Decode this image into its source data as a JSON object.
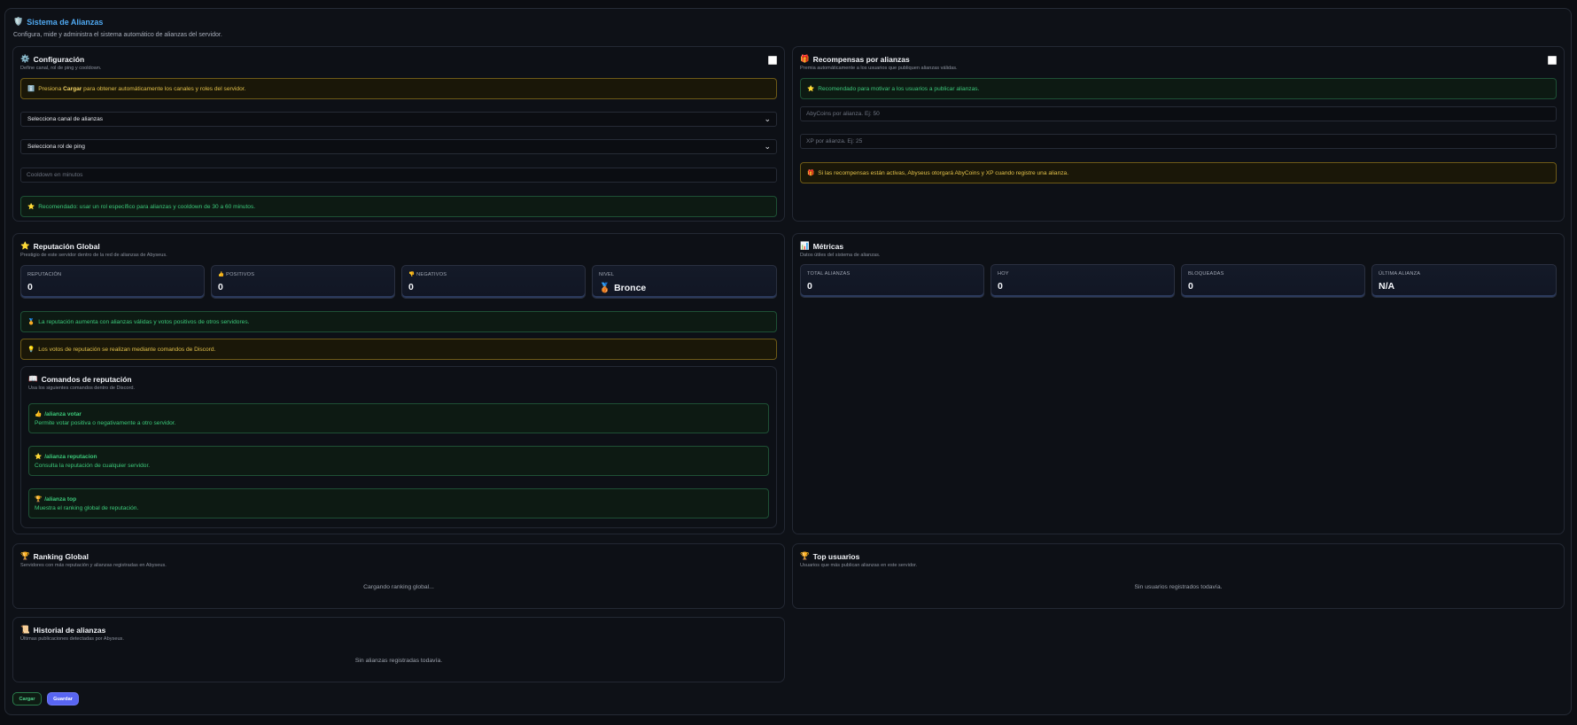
{
  "header": {
    "icon": "shield-icon",
    "title": "Sistema de Alianzas",
    "subtitle": "Configura, mide y administra el sistema automático de alianzas del servidor."
  },
  "config": {
    "icon": "gear-icon",
    "title": "Configuración",
    "subtitle": "Define canal, rol de ping y cooldown.",
    "notice_pre": "Presiona ",
    "notice_bold": "Cargar",
    "notice_post": " para obtener automáticamente los canales y roles del servidor.",
    "channel_select": "Selecciona canal de alianzas",
    "role_select": "Selecciona rol de ping",
    "cooldown_placeholder": "Cooldown en minutos",
    "recommend": "Recomendado: usar un rol específico para alianzas y cooldown de 30 a 60 minutos."
  },
  "rewards": {
    "icon": "gift-icon",
    "title": "Recompensas por alianzas",
    "subtitle": "Premia automáticamente a los usuarios que publiquen alianzas válidas.",
    "recommend": "Recomendado para motivar a los usuarios a publicar alianzas.",
    "abycoins_placeholder": "AbyCoins por alianza. Ej: 50",
    "xp_placeholder": "XP por alianza. Ej: 25",
    "info": "Si las recompensas están activas, Abyseus otorgará AbyCoins y XP cuando registre una alianza."
  },
  "reputation": {
    "icon": "star-icon",
    "title": "Reputación Global",
    "subtitle": "Prestigio de este servidor dentro de la red de alianzas de Abyseus.",
    "stats": [
      {
        "label": "REPUTACIÓN",
        "value": "0"
      },
      {
        "label": "POSITIVOS",
        "value": "0"
      },
      {
        "label": "NEGATIVOS",
        "value": "0"
      },
      {
        "label": "NIVEL",
        "value": "Bronce"
      }
    ],
    "notice_ok": "La reputación aumenta con alianzas válidas y votos positivos de otros servidores.",
    "notice_warn": "Los votos de reputación se realizan mediante comandos de Discord.",
    "commands": {
      "title": "Comandos de reputación",
      "subtitle": "Usa los siguientes comandos dentro de Discord.",
      "items": [
        {
          "name": "/alianza votar",
          "desc": "Permite votar positiva o negativamente a otro servidor."
        },
        {
          "name": "/alianza reputacion",
          "desc": "Consulta la reputación de cualquier servidor."
        },
        {
          "name": "/alianza top",
          "desc": "Muestra el ranking global de reputación."
        }
      ]
    }
  },
  "metrics": {
    "icon": "chart-icon",
    "title": "Métricas",
    "subtitle": "Datos útiles del sistema de alianzas.",
    "stats": [
      {
        "label": "TOTAL ALIANZAS",
        "value": "0"
      },
      {
        "label": "HOY",
        "value": "0"
      },
      {
        "label": "BLOQUEADAS",
        "value": "0"
      },
      {
        "label": "ÚLTIMA ALIANZA",
        "value": "N/A"
      }
    ]
  },
  "ranking": {
    "icon": "trophy-icon",
    "title": "Ranking Global",
    "subtitle": "Servidores con más reputación y alianzas registradas en Abyseus.",
    "empty": "Cargando ranking global..."
  },
  "top_users": {
    "icon": "trophy-icon",
    "title": "Top usuarios",
    "subtitle": "Usuarios que más publican alianzas en este servidor.",
    "empty": "Sin usuarios registrados todavía."
  },
  "history": {
    "icon": "scroll-icon",
    "title": "Historial de alianzas",
    "subtitle": "Últimas publicaciones detectadas por Abyseus.",
    "empty": "Sin alianzas registradas todavía."
  },
  "actions": {
    "load": "Cargar",
    "save": "Guardar"
  },
  "colors": {
    "accent": "#4fa8f0",
    "success": "#3cc97a",
    "warning": "#e2c04a",
    "primary_button": "#5865f2"
  }
}
